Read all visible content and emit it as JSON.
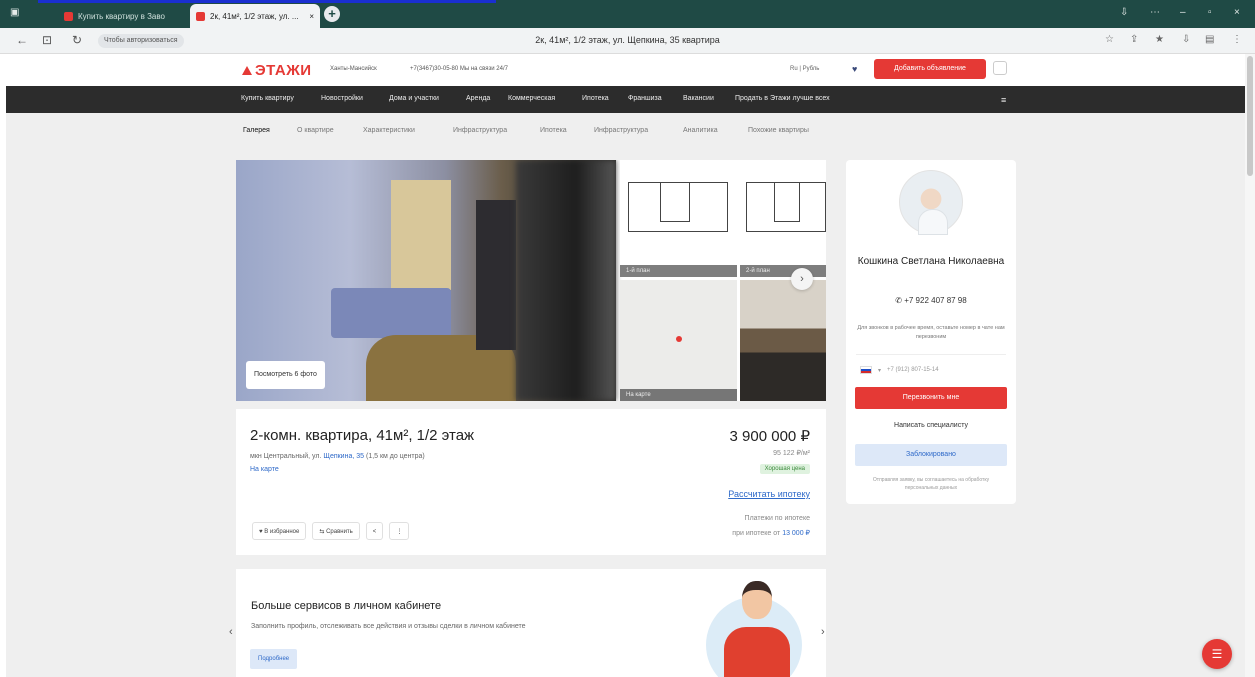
{
  "browser": {
    "tabs": [
      {
        "label": "Купить квартиру в Заво"
      },
      {
        "label": "2к, 41м², 1/2 этаж, ул. ..."
      }
    ],
    "address_chip": "Чтобы авторизоваться",
    "url": "2к, 41м², 1/2 этаж, ул. Щепкина, 35 квартира"
  },
  "header": {
    "logo": "ЭТАЖИ",
    "city": "Ханты-Мансийск",
    "phone": "+7(3467)30-05-80  Мы на связи 24/7",
    "language": "Ru | Рубль",
    "add_button": "Добавить объявление"
  },
  "menu": {
    "items": [
      "Купить квартиру",
      "Новостройки",
      "Дома и участки",
      "Аренда",
      "Коммерческая",
      "Ипотека",
      "Франшиза",
      "Вакансии",
      "Продать в Этажи лучше всех"
    ]
  },
  "subnav": {
    "items": [
      "Галерея",
      "О квартире",
      "Характеристики",
      "Инфраструктура",
      "Ипотека",
      "Инфраструктура",
      "Аналитика",
      "Похожие квартиры"
    ]
  },
  "gallery": {
    "show_photos_label": "Посмотреть 6 фото",
    "thumb_captions": [
      "1-й план",
      "2-й план",
      "На карте"
    ]
  },
  "listing": {
    "title": "2-комн. квартира, 41м², 1/2 этаж",
    "address_prefix": "мкн Центральный, ул.",
    "address_link": "Щепкина, 35",
    "address_suffix": "(1,5 км до центра)",
    "on_map": "На карте",
    "price": "3 900 000 ₽",
    "price_per_m2": "95 122 ₽/м²",
    "badge": "Хорошая цена",
    "calc_link": "Рассчитать ипотеку",
    "mortgage_line1": "Платежи по ипотеке",
    "mortgage_line2_prefix": "при ипотеке от",
    "mortgage_amount": "13 000 ₽",
    "actions": [
      "В избранное",
      "Сравнить",
      "<",
      "⋮"
    ]
  },
  "agent": {
    "name": "Кошкина Светлана Николаевна",
    "phone": "+7 922 407 87 98",
    "note": "Для звонков в рабочее время, оставьте номер в чате нам перезвоним",
    "phone_input_placeholder": "+7 (912) 807-15-14",
    "call_button": "Перезвонить мне",
    "write_label": "Написать специалисту",
    "chat_button": "Заблокировано",
    "legal": "Отправляя заявку, вы соглашаетесь на обработку персональных данных"
  },
  "promo": {
    "title": "Больше сервисов в личном кабинете",
    "text": "Заполнить профиль, отслеживать все действия и отзывы сделки в личном кабинете",
    "button": "Подробнее"
  },
  "colors": {
    "accent": "#e53935",
    "link": "#2f6ac9",
    "menu_bg": "#2c2c2c",
    "tabbar": "#1f4a45"
  }
}
